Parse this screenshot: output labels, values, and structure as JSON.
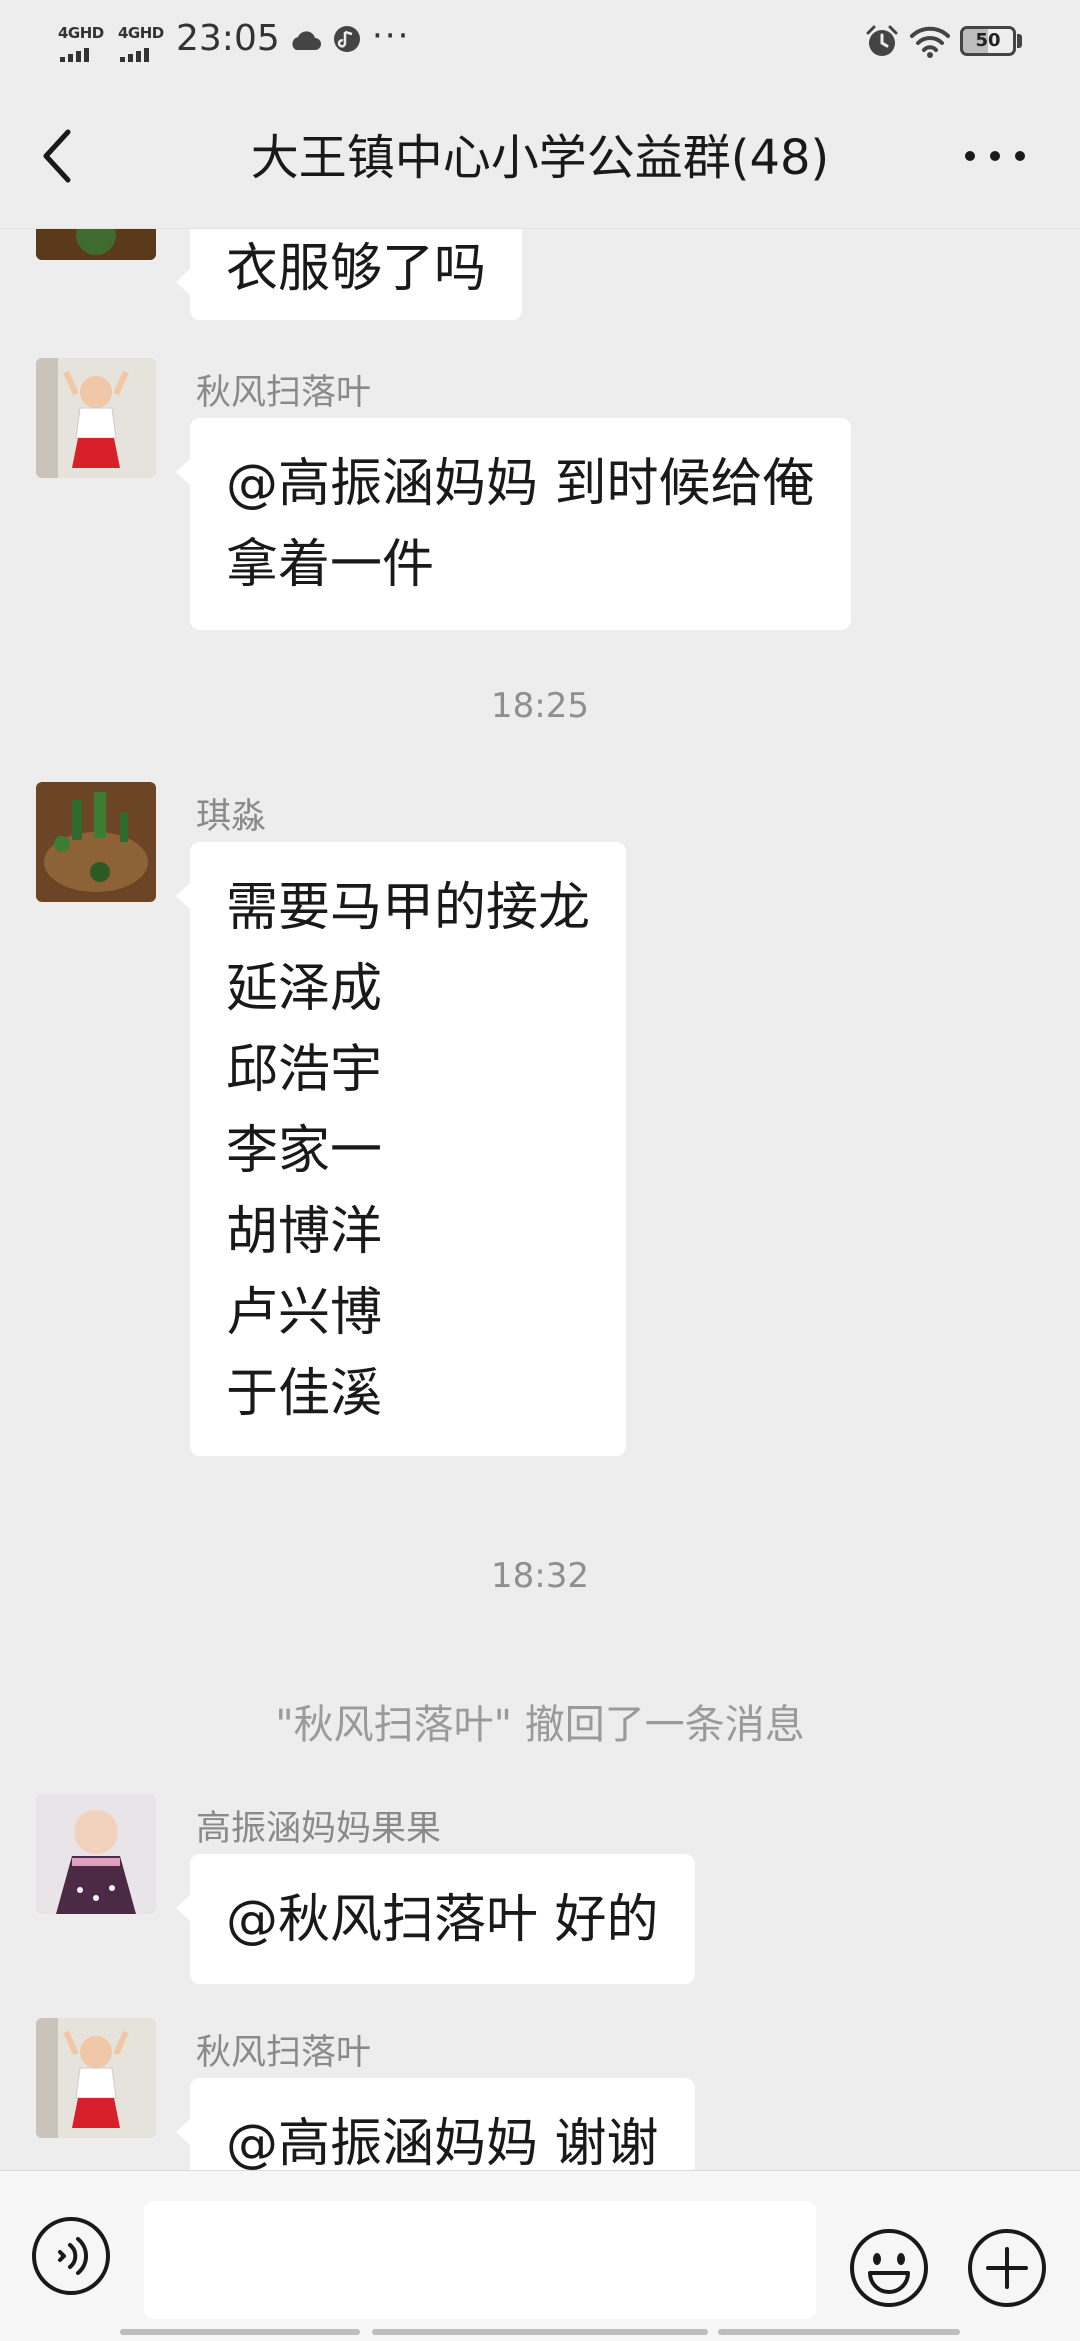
{
  "status_bar": {
    "network_1": "4GHD",
    "network_2": "4GHD",
    "time": "23:05",
    "more": "···",
    "battery": "50"
  },
  "nav": {
    "title": "大王镇中心小学公益群(48)"
  },
  "messages": [
    {
      "sender": "",
      "lines": [
        "衣服够了吗"
      ]
    },
    {
      "sender": "秋风扫落叶",
      "lines": [
        "@高振涵妈妈  到时候给俺",
        "拿着一件"
      ]
    },
    {
      "sender": "琪淼",
      "lines": [
        "需要马甲的接龙",
        "延泽成",
        "邱浩宇",
        "李家一",
        "胡博洋",
        "卢兴博",
        "于佳溪"
      ]
    },
    {
      "sender": "高振涵妈妈果果",
      "lines": [
        "@秋风扫落叶  好的"
      ]
    },
    {
      "sender": "秋风扫落叶",
      "lines": [
        "@高振涵妈妈  谢谢"
      ]
    }
  ],
  "timestamps": [
    "18:25",
    "18:32"
  ],
  "system_message": "\"秋风扫落叶\" 撤回了一条消息",
  "input": {
    "value": "",
    "placeholder": ""
  },
  "icons": {
    "back": "chevron-left-icon",
    "more": "more-horizontal-icon",
    "voice": "voice-icon",
    "emoji": "emoji-icon",
    "plus": "plus-circle-icon"
  }
}
